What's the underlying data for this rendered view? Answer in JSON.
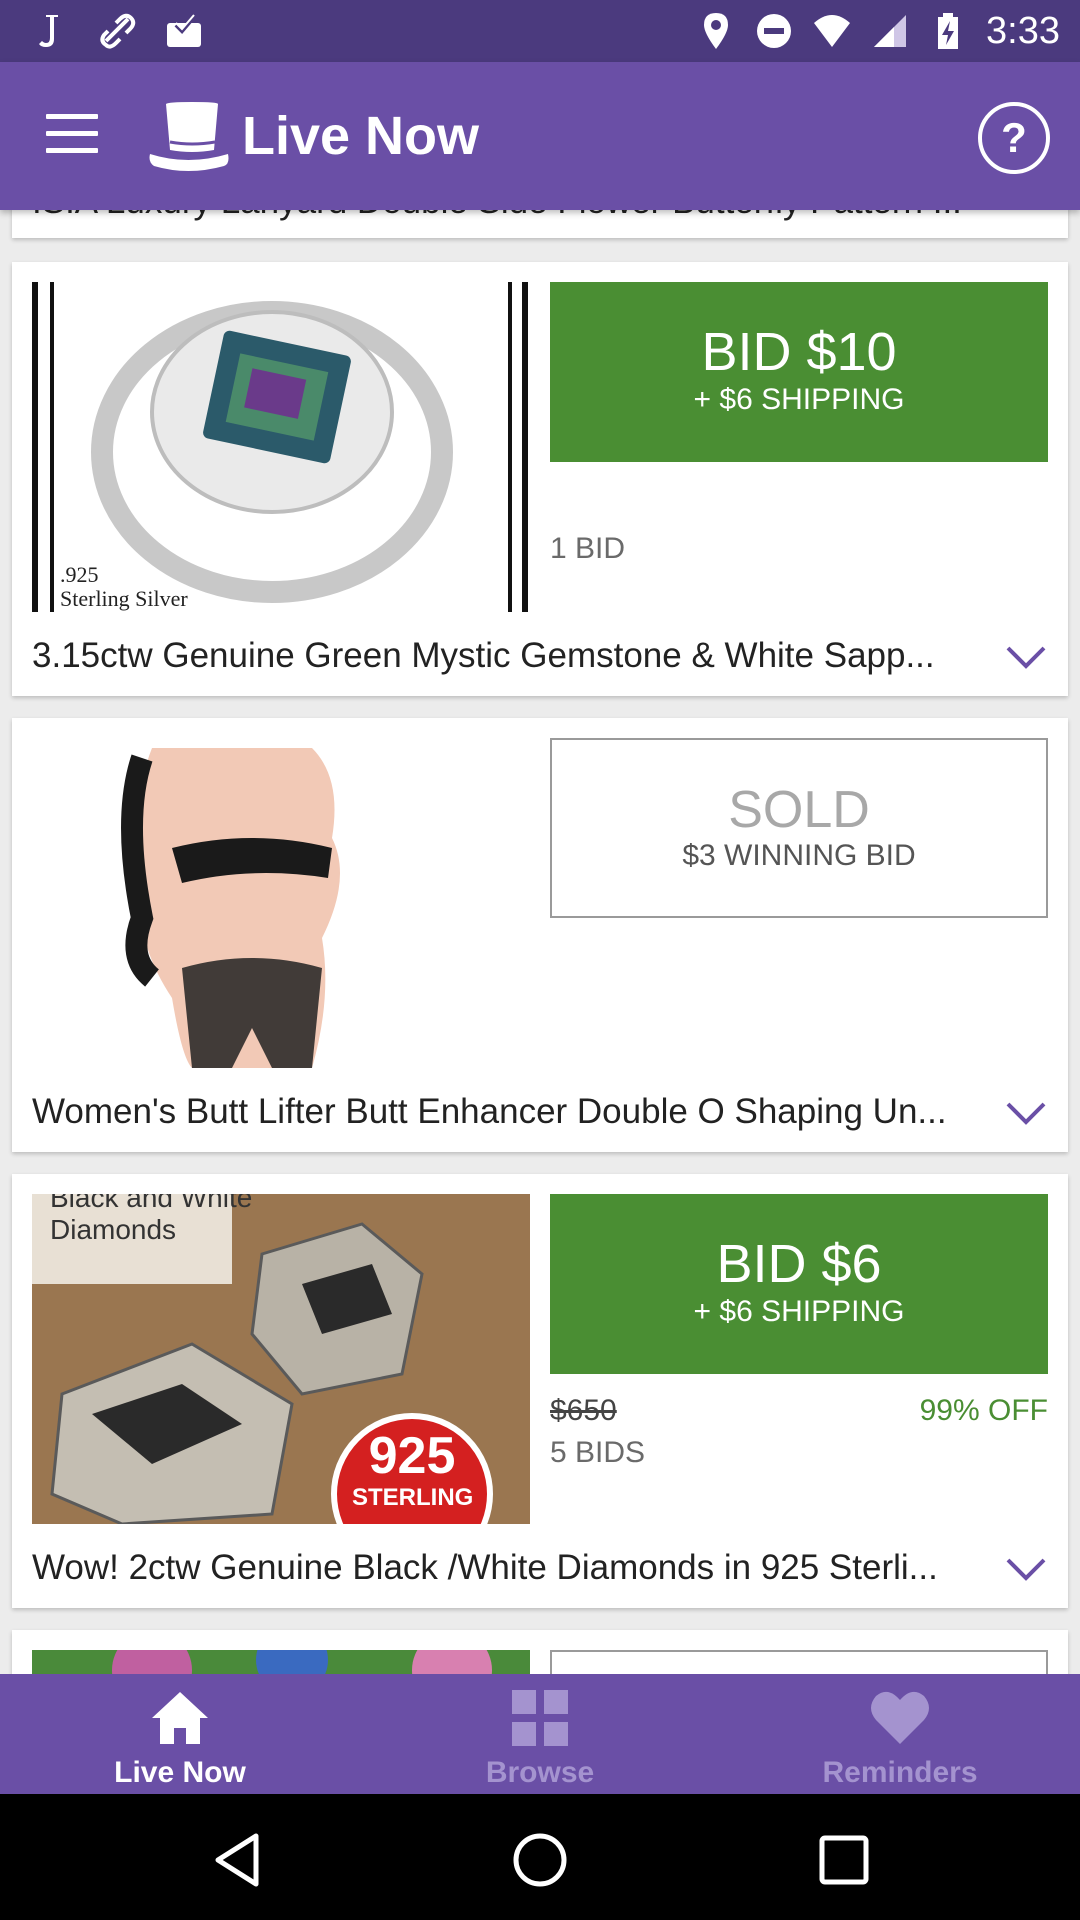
{
  "status_bar": {
    "time": "3:33",
    "left_icons": [
      "j-app-icon",
      "link-icon",
      "inbox-check-icon"
    ],
    "right_icons": [
      "location-icon",
      "do-not-disturb-icon",
      "wifi-icon",
      "signal-icon",
      "battery-charging-icon"
    ]
  },
  "app_bar": {
    "title": "Live Now",
    "help_label": "?"
  },
  "items": [
    {
      "title": "ISIA Luxury Lanyard Double Side Flower Butterfly Pattern ..."
    },
    {
      "title": "3.15ctw Genuine Green Mystic Gemstone & White Sapp...",
      "bid_label": "BID $10",
      "shipping": "+ $6 SHIPPING",
      "bids": "1 BID",
      "image_caption_1": ".925",
      "image_caption_2": "Sterling Silver"
    },
    {
      "title": "Women's Butt Lifter Butt Enhancer Double O Shaping Un...",
      "status": "SOLD",
      "winning_bid": "$3 WINNING BID"
    },
    {
      "title": "Wow! 2ctw Genuine Black /White Diamonds in 925 Sterli...",
      "bid_label": "BID $6",
      "shipping": "+ $6 SHIPPING",
      "original_price": "$650",
      "discount": "99% OFF",
      "bids": "5 BIDS",
      "image_caption_1": "Black and White",
      "image_caption_2": "Diamonds",
      "badge_1": "925",
      "badge_2": "STERLING"
    }
  ],
  "bottom_nav": {
    "tabs": [
      {
        "label": "Live Now",
        "icon": "home-icon",
        "active": true
      },
      {
        "label": "Browse",
        "icon": "grid-icon",
        "active": false
      },
      {
        "label": "Reminders",
        "icon": "heart-icon",
        "active": false
      }
    ]
  },
  "colors": {
    "primary": "#6a4fa6",
    "status_bar": "#4b3a7e",
    "bid_green": "#4a8e33",
    "inactive_tab": "#a493cf"
  }
}
